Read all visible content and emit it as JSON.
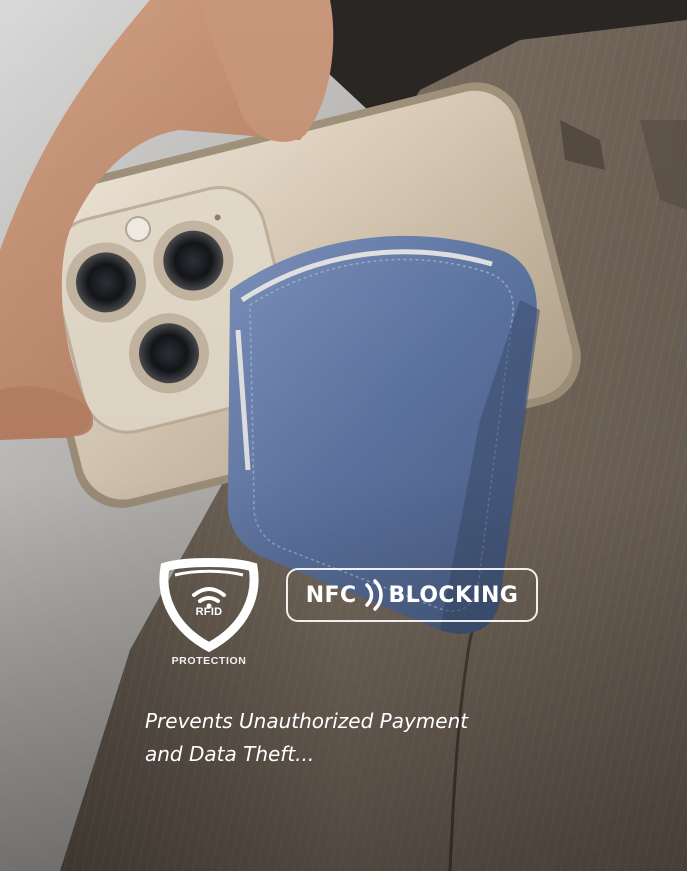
{
  "image": {
    "description_free": true,
    "colors": {
      "wallet_blue": "#5f76a4",
      "trouser_brown": "#6e6155",
      "phone_titanium": "#d8cbb9",
      "overlay_text": "#ffffff"
    }
  },
  "badges": {
    "rfid": {
      "icon": "shield-wifi-icon",
      "label": "RFID",
      "caption": "PROTECTION"
    },
    "nfc": {
      "left_word": "NFC",
      "icon": "nfc-waves-icon",
      "right_word": "BLOCKING"
    }
  },
  "caption": {
    "line1": "Prevents Unauthorized Payment",
    "line2": "and Data Theft..."
  }
}
